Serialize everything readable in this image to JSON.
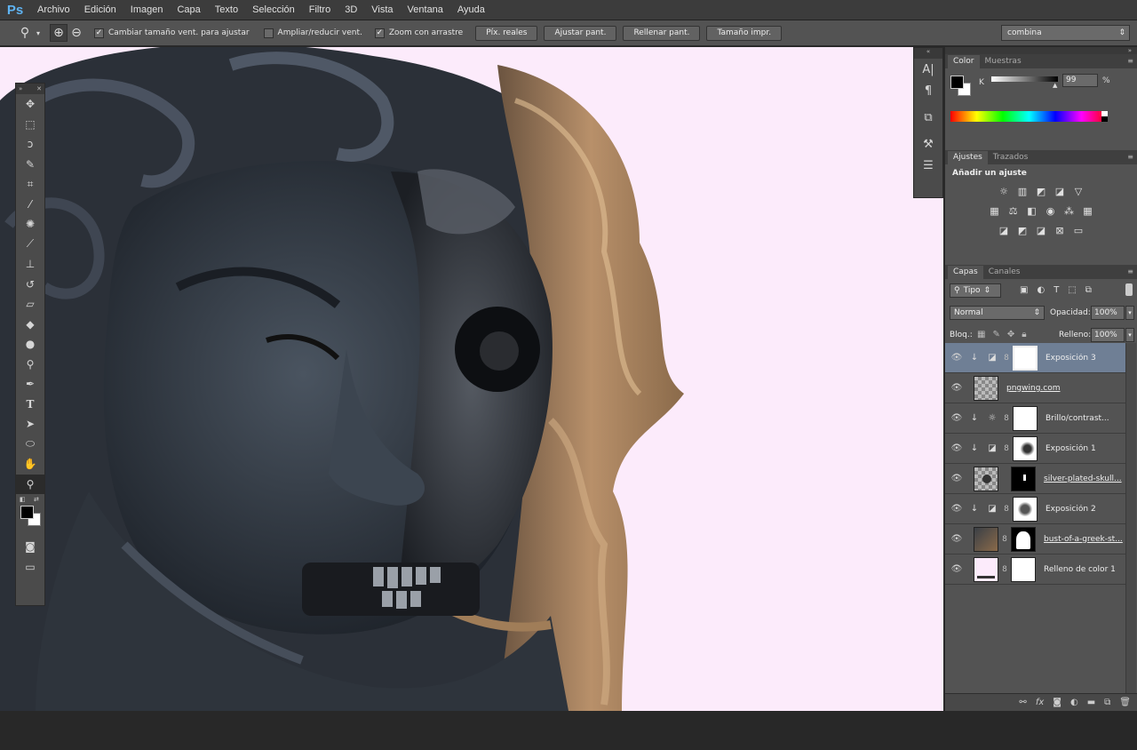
{
  "menubar": {
    "logo": "Ps",
    "items": [
      "Archivo",
      "Edición",
      "Imagen",
      "Capa",
      "Texto",
      "Selección",
      "Filtro",
      "3D",
      "Vista",
      "Ventana",
      "Ayuda"
    ]
  },
  "options": {
    "check_resize": "Cambiar tamaño vent. para ajustar",
    "check_zoom_all": "Ampliar/reducir vent.",
    "check_scrubby": "Zoom con arrastre",
    "btn_actual": "Píx. reales",
    "btn_fit": "Ajustar pant.",
    "btn_fill": "Rellenar pant.",
    "btn_print": "Tamaño impr.",
    "workspace": "combina"
  },
  "color_panel": {
    "tab_color": "Color",
    "tab_swatches": "Muestras",
    "channel": "K",
    "value": "99",
    "unit": "%"
  },
  "adjustments": {
    "tab_adjust": "Ajustes",
    "tab_paths": "Trazados",
    "title": "Añadir un ajuste"
  },
  "layers_panel": {
    "tab_layers": "Capas",
    "tab_channels": "Canales",
    "filter_kind": "Tipo",
    "blend_mode": "Normal",
    "opacity_label": "Opacidad:",
    "opacity_value": "100%",
    "lock_label": "Bloq.:",
    "fill_label": "Relleno:",
    "fill_value": "100%",
    "layers": [
      {
        "name": "Exposición 3"
      },
      {
        "name": "pngwing.com"
      },
      {
        "name": "Brillo/contrast..."
      },
      {
        "name": "Exposición 1"
      },
      {
        "name": "silver-plated-skull..."
      },
      {
        "name": "Exposición 2"
      },
      {
        "name": "bust-of-a-greek-st..."
      },
      {
        "name": "Relleno de color 1"
      }
    ]
  },
  "colors": {
    "canvas_bg": "#fcebfb",
    "selected_layer": "#6f7f95",
    "ps_blue": "#5fb4f3"
  }
}
